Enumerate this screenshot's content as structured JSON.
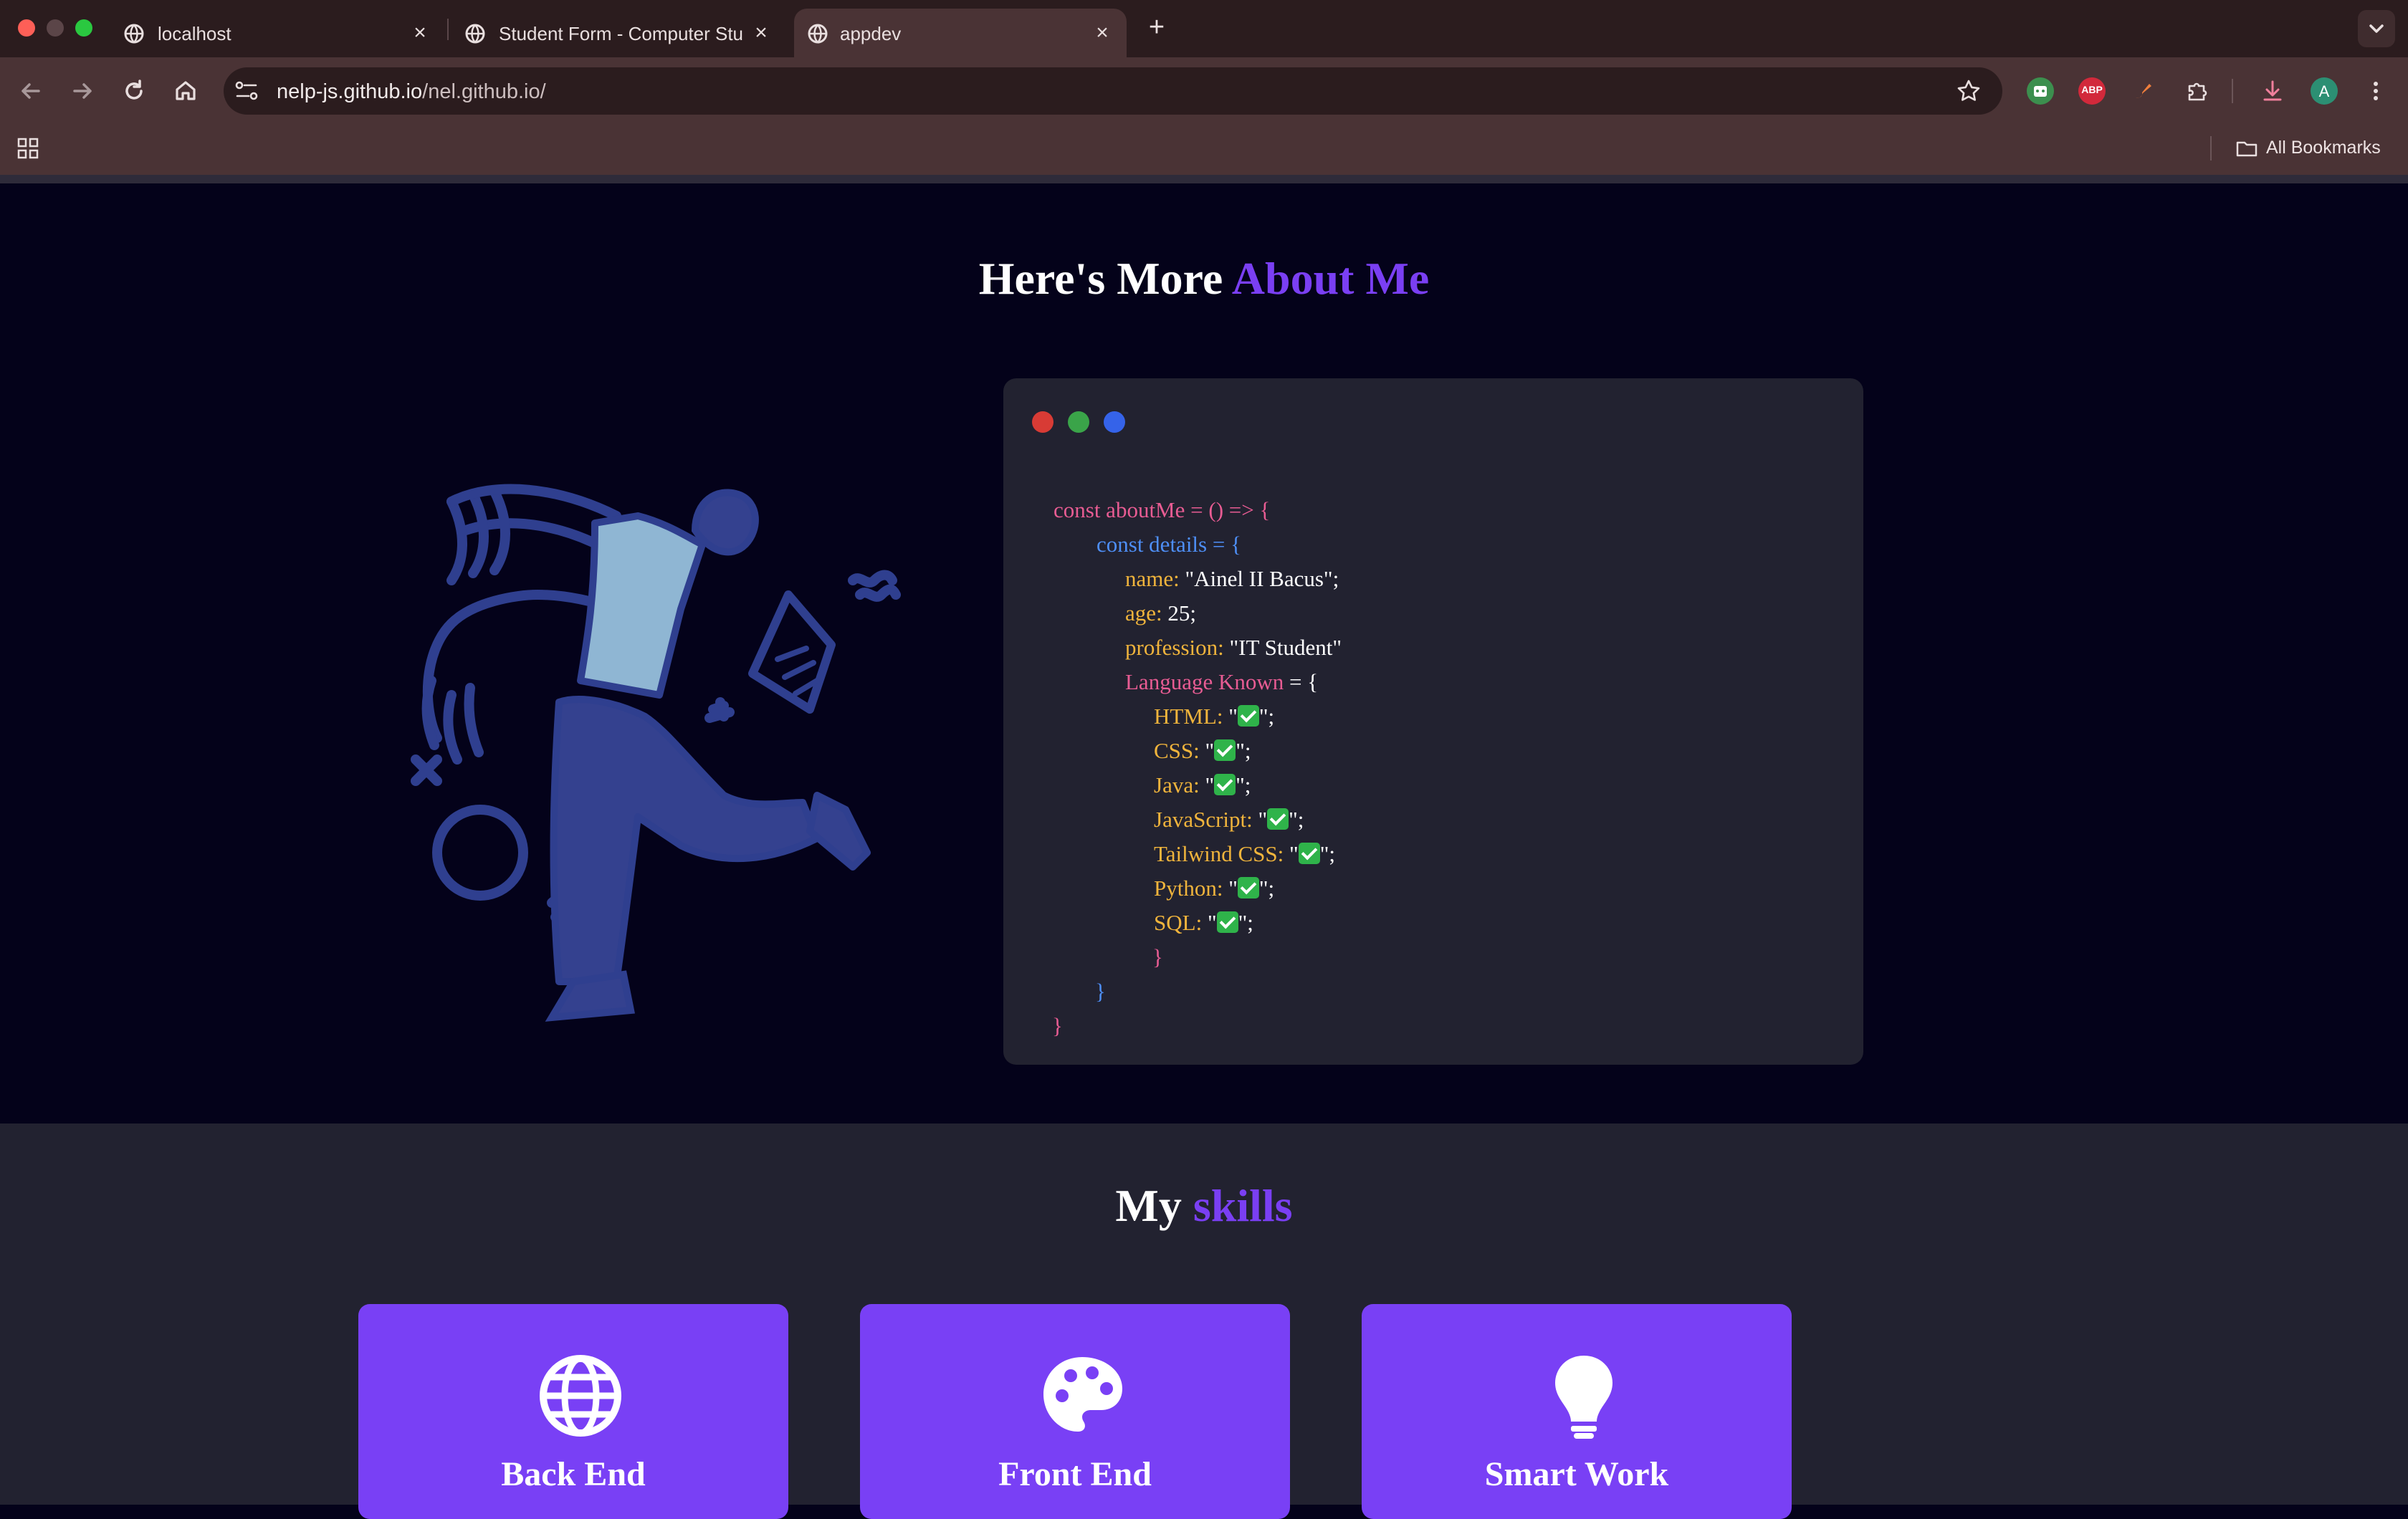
{
  "browser": {
    "tabs": [
      {
        "label": "localhost"
      },
      {
        "label": "Student Form - Computer Stu"
      },
      {
        "label": "appdev",
        "active": true
      }
    ],
    "url": {
      "domain": "nelp-js.github.io",
      "path": "/nel.github.io/"
    },
    "bookmarks_label": "All Bookmarks",
    "profile_initial": "A",
    "ext_abp": "ABP"
  },
  "about": {
    "heading_prefix": "Here's More ",
    "heading_accent": "About Me"
  },
  "code": {
    "line1": "const aboutMe = () => {",
    "line2": "const details = {",
    "name_key": "name:",
    "name_val": " \"Ainel II Bacus\";",
    "age_key": "age:",
    "age_val": " 25;",
    "prof_key": "profession:",
    "prof_val": " \"IT Student\"",
    "lang_key": "Language Known",
    "lang_open": " = {",
    "languages": [
      "HTML:",
      "CSS:",
      "Java:",
      "JavaScript:",
      "Tailwind CSS:",
      "Python:",
      "SQL:"
    ],
    "quote_open": " \"",
    "quote_close": "\";",
    "close_brace": "}"
  },
  "skills": {
    "heading_prefix": "My ",
    "heading_accent": "skills",
    "cards": [
      {
        "title": "Back End",
        "icon": "globe-icon"
      },
      {
        "title": "Front End",
        "icon": "palette-icon"
      },
      {
        "title": "Smart Work",
        "icon": "lightbulb-icon"
      }
    ]
  },
  "colors": {
    "accent": "#7a3ff3",
    "card": "#7940f5",
    "code_pink": "#e85c93",
    "code_blue": "#4e8ff7",
    "code_gold": "#f0b43c"
  }
}
